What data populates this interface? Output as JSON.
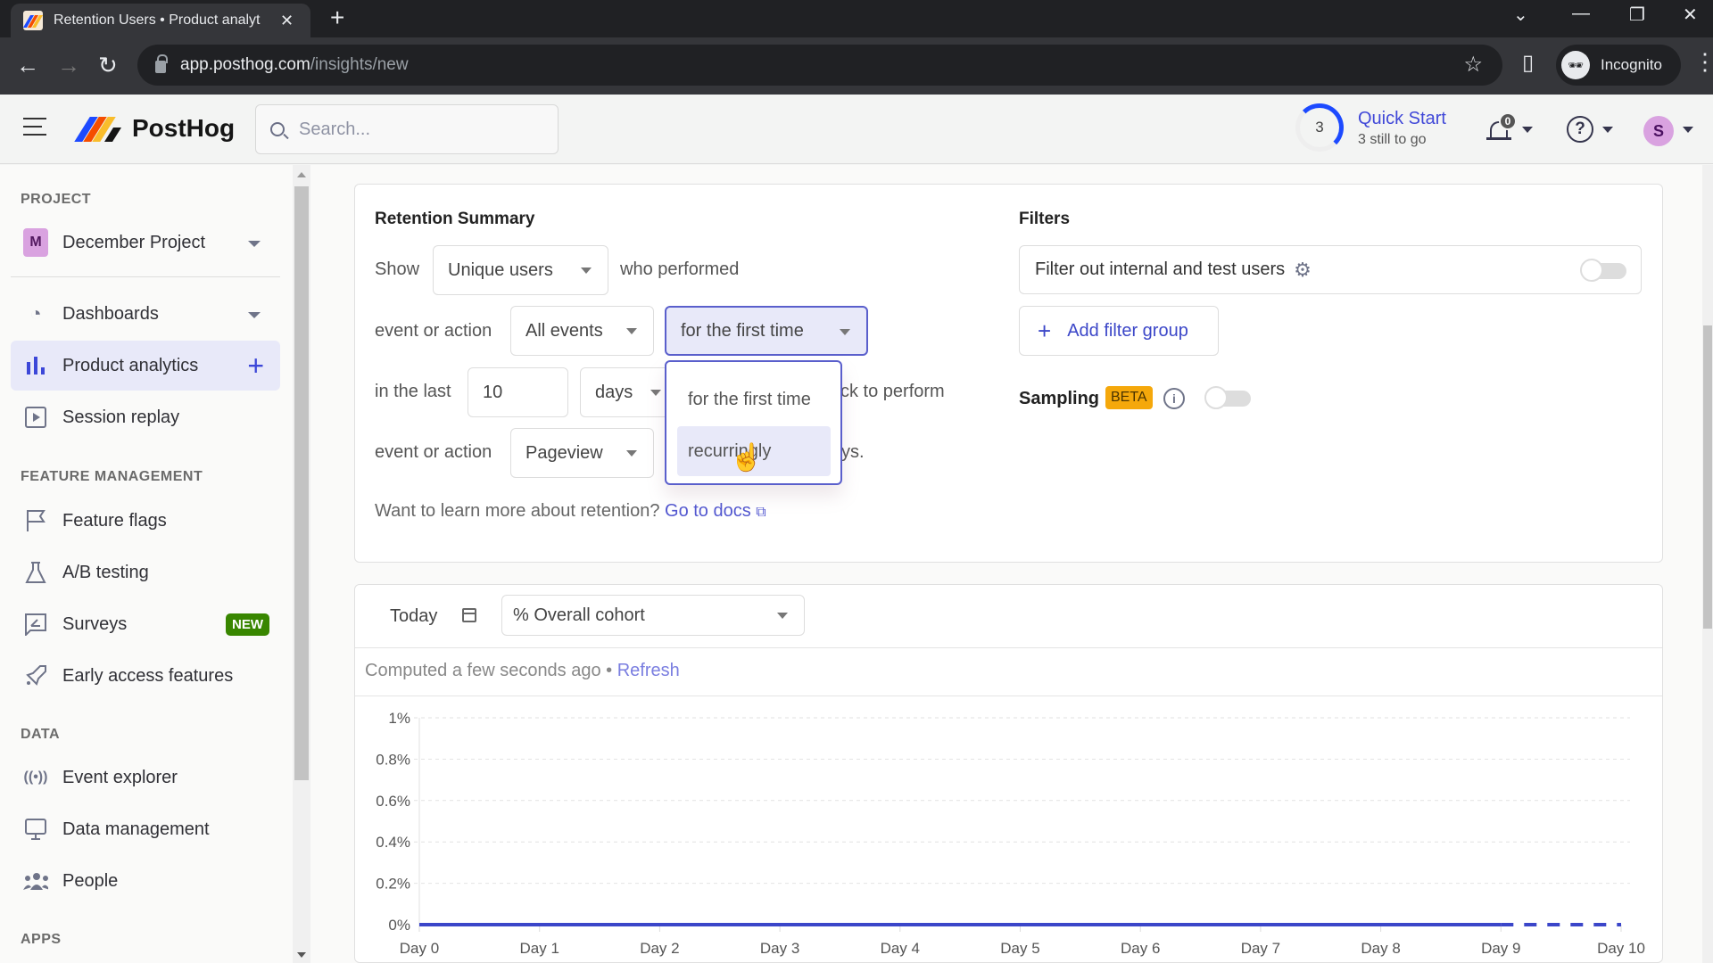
{
  "browser": {
    "tab_title": "Retention Users • Product analyt",
    "url_host": "app.posthog.com",
    "url_path": "/insights/new",
    "profile_label": "Incognito"
  },
  "topbar": {
    "brand": "PostHog",
    "search_placeholder": "Search...",
    "quick_start": {
      "title": "Quick Start",
      "subtitle": "3 still to go",
      "remaining": "3"
    },
    "notifications_count": "0",
    "help_icon": "?",
    "avatar_initial": "S"
  },
  "sidebar": {
    "sections": {
      "project": "PROJECT",
      "feature_management": "FEATURE MANAGEMENT",
      "data": "DATA",
      "apps": "APPS"
    },
    "project": {
      "initial": "M",
      "name": "December Project"
    },
    "items": [
      {
        "label": "Dashboards",
        "icon": "dashboard-gauge-icon"
      },
      {
        "label": "Product analytics",
        "icon": "bar-chart-icon",
        "active": true
      },
      {
        "label": "Session replay",
        "icon": "play-square-icon"
      },
      {
        "label": "Feature flags",
        "icon": "flag-icon"
      },
      {
        "label": "A/B testing",
        "icon": "flask-icon"
      },
      {
        "label": "Surveys",
        "icon": "survey-icon",
        "badge": "NEW"
      },
      {
        "label": "Early access features",
        "icon": "rocket-icon"
      },
      {
        "label": "Event explorer",
        "icon": "broadcast-icon"
      },
      {
        "label": "Data management",
        "icon": "monitor-icon"
      },
      {
        "label": "People",
        "icon": "people-icon"
      }
    ]
  },
  "retention": {
    "title": "Retention Summary",
    "show_label": "Show",
    "show_value": "Unique users",
    "who_performed": "who performed",
    "event_or_action_label": "event or action",
    "start_event": "All events",
    "period_type": "for the first time",
    "in_the_last_label": "in the last",
    "period_count": "10",
    "period_unit": "days",
    "came_back_text": "and came back to perform",
    "return_event": "Pageview",
    "suffix_text": "in any of the next periods.",
    "visible_came_back": "ck to perform",
    "visible_suffix": "ys.",
    "learn_more": "Want to learn more about retention?",
    "docs_link": "Go to docs",
    "dropdown_options": [
      "for the first time",
      "recurringly"
    ],
    "hovered_option": "recurringly"
  },
  "filters": {
    "title": "Filters",
    "internal_filter_label": "Filter out internal and test users",
    "internal_filter_on": false,
    "add_filter_group": "Add filter group",
    "sampling_label": "Sampling",
    "sampling_badge": "BETA",
    "sampling_on": false
  },
  "results": {
    "date_label": "Today",
    "metric_select": "% Overall cohort",
    "computed_text": "Computed a few seconds ago",
    "refresh_label": "Refresh"
  },
  "colors": {
    "accent": "#1d4aff",
    "link": "#5358d0",
    "line": "#3b46c9",
    "new_badge": "#388600",
    "beta_badge": "#f5a80b",
    "active_bg": "#e8e9f9"
  },
  "chart_data": {
    "type": "line",
    "title": "",
    "xlabel": "",
    "ylabel": "",
    "categories": [
      "Day 0",
      "Day 1",
      "Day 2",
      "Day 3",
      "Day 4",
      "Day 5",
      "Day 6",
      "Day 7",
      "Day 8",
      "Day 9",
      "Day 10"
    ],
    "series": [
      {
        "name": "Overall cohort",
        "values": [
          0,
          0,
          0,
          0,
          0,
          0,
          0,
          0,
          0,
          0,
          0
        ],
        "dashed_from_index": 9
      }
    ],
    "yticks": [
      "0%",
      "0.2%",
      "0.4%",
      "0.6%",
      "0.8%",
      "1%"
    ],
    "ytick_values": [
      0,
      0.2,
      0.4,
      0.6,
      0.8,
      1
    ],
    "ylim": [
      0,
      1
    ],
    "grid": true,
    "legend": "none"
  }
}
